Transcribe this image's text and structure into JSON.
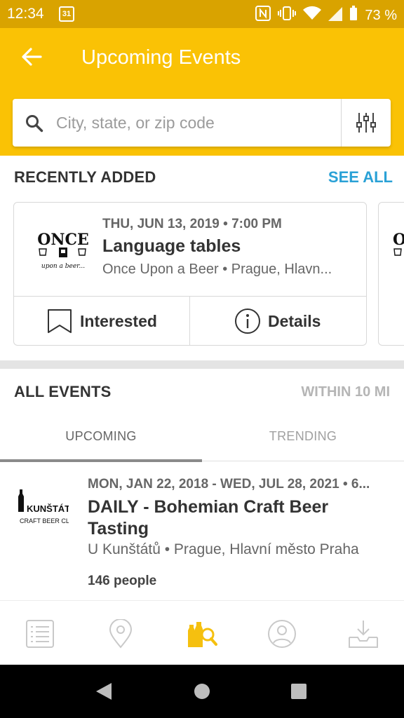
{
  "status_bar": {
    "time": "12:34",
    "calendar_day": "31",
    "nfc": "N",
    "battery": "73 %"
  },
  "header": {
    "title": "Upcoming Events",
    "search_placeholder": "City, state, or zip code"
  },
  "recently_added": {
    "heading": "RECENTLY ADDED",
    "see_all": "SEE ALL",
    "card": {
      "logo_text_top": "ONCE",
      "logo_text_bottom": "upon a beer...",
      "date": "THU, JUN 13, 2019 • 7:00 PM",
      "name": "Language tables",
      "venue": "Once Upon a Beer • Prague, Hlavn...",
      "interested_label": "Interested",
      "details_label": "Details"
    }
  },
  "all_events": {
    "heading": "ALL EVENTS",
    "radius": "WITHIN 10 MI",
    "tabs": [
      {
        "label": "UPCOMING",
        "active": true
      },
      {
        "label": "TRENDING",
        "active": false
      }
    ],
    "events": [
      {
        "logo_text_top": "U KUNŠTÁTŮ",
        "logo_text_bottom": "CRAFT BEER CLUB",
        "date": "MON, JAN 22, 2018 - WED, JUL 28, 2021 • 6...",
        "name": "DAILY - Bohemian Craft Beer Tasting",
        "venue": "U Kunštátů • Prague, Hlavní město Praha",
        "people": "146 people"
      }
    ]
  },
  "bottom_nav": [
    {
      "icon": "list-icon",
      "active": false
    },
    {
      "icon": "map-pin-icon",
      "active": false
    },
    {
      "icon": "beer-search-icon",
      "active": true
    },
    {
      "icon": "profile-icon",
      "active": false
    },
    {
      "icon": "download-icon",
      "active": false
    }
  ],
  "colors": {
    "status_bar": "#d9a300",
    "header": "#fac205",
    "accent_link": "#2aa1d6",
    "nav_active": "#f5c00f",
    "nav_inactive": "#c9c9c9"
  }
}
